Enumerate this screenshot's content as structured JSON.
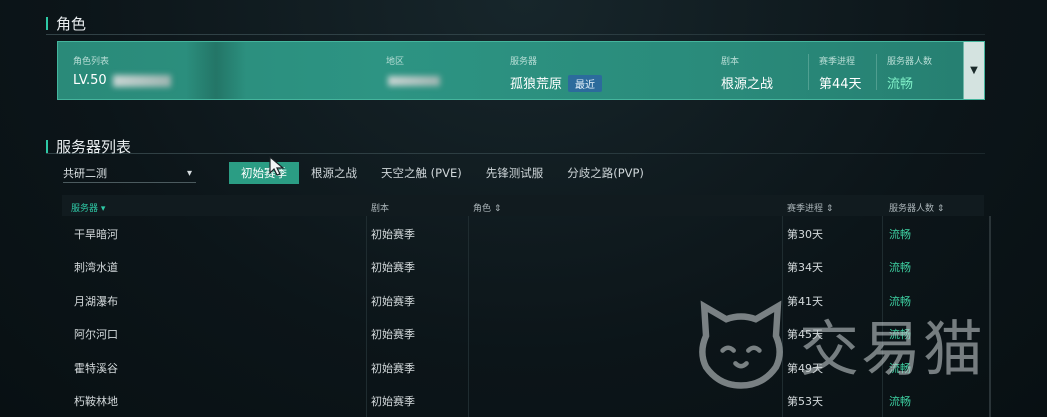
{
  "sections": {
    "character": "角色",
    "server_list": "服务器列表"
  },
  "character_card": {
    "labels": {
      "role_list": "角色列表",
      "region": "地区",
      "server": "服务器",
      "script": "剧本",
      "season": "赛季进程",
      "population": "服务器人数"
    },
    "level": "LV.50",
    "server": "孤狼荒原",
    "server_badge": "最近",
    "script": "根源之战",
    "season": "第44天",
    "population": "流畅",
    "expand_icon": "chevron-down-icon"
  },
  "region_select": {
    "value": "共研二测"
  },
  "tabs": [
    "初始赛季",
    "根源之战",
    "天空之触 (PVE)",
    "先锋测试服",
    "分歧之路(PVP)"
  ],
  "active_tab": 0,
  "table": {
    "headers": {
      "server": "服务器 ▾",
      "script": "剧本",
      "role": "角色 ⇕",
      "season": "赛季进程 ⇕",
      "population": "服务器人数 ⇕"
    },
    "rows": [
      {
        "server": "干旱暗河",
        "script": "初始赛季",
        "role": "",
        "season": "第30天",
        "population": "流畅"
      },
      {
        "server": "刺湾水道",
        "script": "初始赛季",
        "role": "",
        "season": "第34天",
        "population": "流畅"
      },
      {
        "server": "月湖瀑布",
        "script": "初始赛季",
        "role": "",
        "season": "第41天",
        "population": "流畅"
      },
      {
        "server": "阿尔河口",
        "script": "初始赛季",
        "role": "",
        "season": "第45天",
        "population": "流畅"
      },
      {
        "server": "霍特溪谷",
        "script": "初始赛季",
        "role": "",
        "season": "第49天",
        "population": "流畅"
      },
      {
        "server": "朽鞍林地",
        "script": "初始赛季",
        "role": "",
        "season": "第53天",
        "population": "流畅"
      }
    ]
  },
  "watermark": {
    "text": "交易猫"
  },
  "colors": {
    "accent": "#2ec9a6",
    "card": "#2a8a79",
    "ok": "#3ed1a2"
  }
}
